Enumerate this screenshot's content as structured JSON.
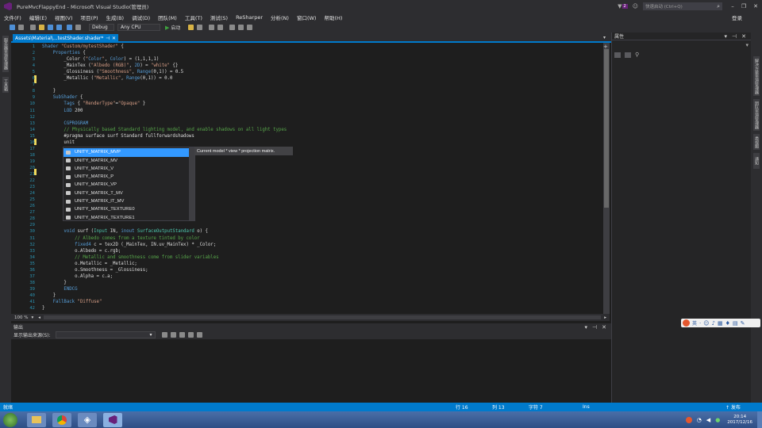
{
  "window": {
    "title": "PureMvcFlappyEnd - Microsoft Visual Studio(管理员)",
    "quick_launch_placeholder": "快速启动 (Ctrl+Q)",
    "notification_count": "2",
    "login": "登录"
  },
  "menu": [
    "文件(F)",
    "编辑(E)",
    "视图(V)",
    "项目(P)",
    "生成(B)",
    "调试(D)",
    "团队(M)",
    "工具(T)",
    "测试(S)",
    "ReSharper",
    "分析(N)",
    "窗口(W)",
    "帮助(H)"
  ],
  "toolbar": {
    "configuration": "Debug",
    "platform": "Any CPU",
    "start": "启动"
  },
  "left_strip": [
    "服务器资源管理器",
    "工具箱"
  ],
  "doc_tab": {
    "label": "Assets\\Material\\...testShader.shader*"
  },
  "code_lines": [
    {
      "n": "1",
      "text": "Shader \"Custom/mytestShader\" {"
    },
    {
      "n": "2",
      "text": "    Properties {"
    },
    {
      "n": "3",
      "text": "        _Color (\"Color\", Color) = (1,1,1,1)"
    },
    {
      "n": "4",
      "text": "        _MainTex (\"Albedo (RGB)\", 2D) = \"white\" {}"
    },
    {
      "n": "5",
      "text": "        _Glossiness (\"Smoothness\", Range(0,1)) = 0.5"
    },
    {
      "n": "6",
      "text": "        _Metallic (\"Metallic\", Range(0,1)) = 0.0"
    },
    {
      "n": "7",
      "text": ""
    },
    {
      "n": "8",
      "text": "    }"
    },
    {
      "n": "9",
      "text": "    SubShader {"
    },
    {
      "n": "10",
      "text": "        Tags { \"RenderType\"=\"Opaque\" }"
    },
    {
      "n": "11",
      "text": "        LOD 200"
    },
    {
      "n": "12",
      "text": ""
    },
    {
      "n": "13",
      "text": "        CGPROGRAM"
    },
    {
      "n": "14",
      "text": "        // Physically based Standard lighting model, and enable shadows on all light types"
    },
    {
      "n": "15",
      "text": "        #pragma surface surf Standard fullforwardshadows"
    },
    {
      "n": "16",
      "text": "        unit"
    },
    {
      "n": "17",
      "text": ""
    },
    {
      "n": "18",
      "text": ""
    },
    {
      "n": "19",
      "text": ""
    },
    {
      "n": "20",
      "text": ""
    },
    {
      "n": "21",
      "text": ""
    },
    {
      "n": "22",
      "text": ""
    },
    {
      "n": "23",
      "text": ""
    },
    {
      "n": "24",
      "text": ""
    },
    {
      "n": "25",
      "text": ""
    },
    {
      "n": "26",
      "text": ""
    },
    {
      "n": "27",
      "text": ""
    },
    {
      "n": "28",
      "text": ""
    },
    {
      "n": "29",
      "text": ""
    },
    {
      "n": "30",
      "text": "        void surf (Input IN, inout SurfaceOutputStandard o) {"
    },
    {
      "n": "31",
      "text": "            // Albedo comes from a texture tinted by color"
    },
    {
      "n": "32",
      "text": "            fixed4 c = tex2D (_MainTex, IN.uv_MainTex) * _Color;"
    },
    {
      "n": "33",
      "text": "            o.Albedo = c.rgb;"
    },
    {
      "n": "34",
      "text": "            // Metallic and smoothness come from slider variables"
    },
    {
      "n": "35",
      "text": "            o.Metallic = _Metallic;"
    },
    {
      "n": "36",
      "text": "            o.Smoothness = _Glossiness;"
    },
    {
      "n": "37",
      "text": "            o.Alpha = c.a;"
    },
    {
      "n": "38",
      "text": "        }"
    },
    {
      "n": "39",
      "text": "        ENDCG"
    },
    {
      "n": "40",
      "text": "    }"
    },
    {
      "n": "41",
      "text": "    FallBack \"Diffuse\""
    },
    {
      "n": "42",
      "text": "}"
    }
  ],
  "autocomplete": {
    "items": [
      "UNITY_MATRIX_MVP",
      "UNITY_MATRIX_MV",
      "UNITY_MATRIX_V",
      "UNITY_MATRIX_P",
      "UNITY_MATRIX_VP",
      "UNITY_MATRIX_T_MV",
      "UNITY_MATRIX_IT_MV",
      "UNITY_MATRIX_TEXTURE0",
      "UNITY_MATRIX_TEXTURE1"
    ],
    "selected_index": 0,
    "tooltip": "Current model * view * projection matrix."
  },
  "editor_footer": {
    "zoom": "100 %"
  },
  "properties_panel": {
    "title": "属性"
  },
  "right_strip": [
    "解决方案资源管理器",
    "团队资源管理器",
    "类视图",
    "通知"
  ],
  "output_panel": {
    "title": "输出",
    "source_label": "显示输出来源(S):"
  },
  "statusbar": {
    "ready": "就绪",
    "line": "行 16",
    "col": "列 13",
    "char": "字符 7",
    "mode": "Ins",
    "publish": "↑ 发布"
  },
  "ime": {
    "lang": "英"
  },
  "taskbar": {
    "time": "20:14",
    "date": "2017/12/16"
  },
  "colors": {
    "accent": "#007acc",
    "selection": "#3399ff",
    "editor_bg": "#1e1e1e"
  }
}
